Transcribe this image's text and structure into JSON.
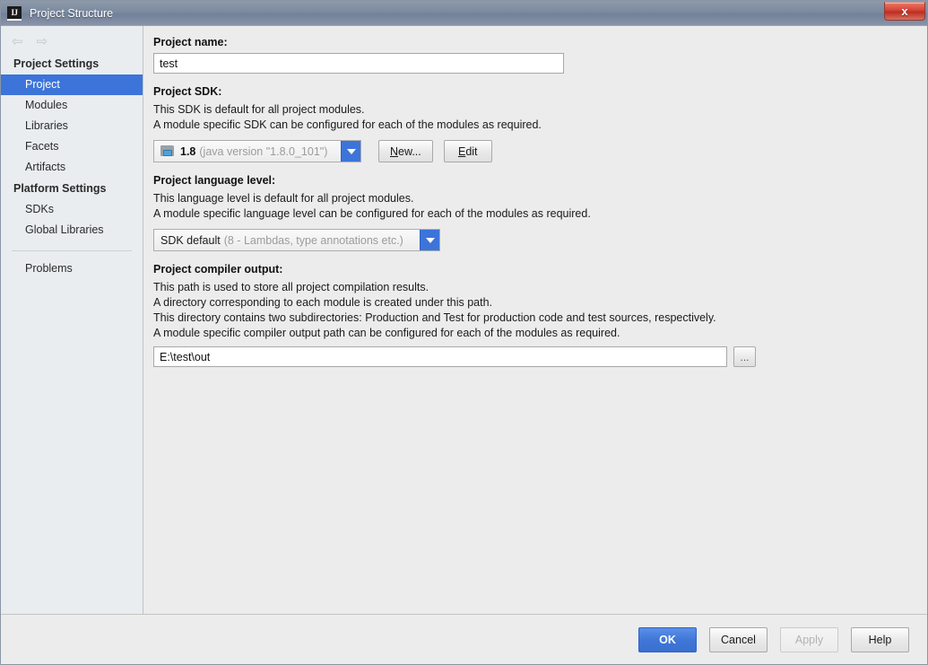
{
  "window": {
    "title": "Project Structure",
    "app_icon": "IJ",
    "close_label": "x"
  },
  "sidebar": {
    "nav": {
      "back_icon": "arrow-left-icon",
      "forward_icon": "arrow-right-icon",
      "back_glyph": "⇦",
      "forward_glyph": "⇨"
    },
    "groups": [
      {
        "title": "Project Settings",
        "items": [
          {
            "label": "Project",
            "selected": true
          },
          {
            "label": "Modules",
            "selected": false
          },
          {
            "label": "Libraries",
            "selected": false
          },
          {
            "label": "Facets",
            "selected": false
          },
          {
            "label": "Artifacts",
            "selected": false
          }
        ]
      },
      {
        "title": "Platform Settings",
        "items": [
          {
            "label": "SDKs",
            "selected": false
          },
          {
            "label": "Global Libraries",
            "selected": false
          }
        ]
      }
    ],
    "problems_label": "Problems"
  },
  "main": {
    "project_name": {
      "label": "Project name:",
      "value": "test"
    },
    "project_sdk": {
      "label": "Project SDK:",
      "description_lines": [
        "This SDK is default for all project modules.",
        "A module specific SDK can be configured for each of the modules as required."
      ],
      "selected_version": "1.8",
      "selected_detail": "(java version \"1.8.0_101\")",
      "new_button": {
        "prefix": "",
        "mnemonic": "N",
        "suffix": "ew..."
      },
      "edit_button": {
        "prefix": "",
        "mnemonic": "E",
        "suffix": "dit"
      }
    },
    "language_level": {
      "label": "Project language level:",
      "description_lines": [
        "This language level is default for all project modules.",
        "A module specific language level can be configured for each of the modules as required."
      ],
      "selected_value": "SDK default",
      "selected_detail": "(8 - Lambdas, type annotations etc.)"
    },
    "compiler_output": {
      "label": "Project compiler output:",
      "description_lines": [
        "This path is used to store all project compilation results.",
        "A directory corresponding to each module is created under this path.",
        "This directory contains two subdirectories: Production and Test for production code and test sources, respectively.",
        "A module specific compiler output path can be configured for each of the modules as required."
      ],
      "path_value": "E:\\test\\out",
      "browse_label": "..."
    }
  },
  "footer": {
    "ok_label": "OK",
    "cancel_label": "Cancel",
    "apply_label": "Apply",
    "help_label": "Help"
  },
  "colors": {
    "accent_blue": "#3c74d9",
    "titlebar_blue_gray": "#7c8a9e",
    "close_red": "#d8493a",
    "sidebar_bg": "#e9edf0",
    "content_bg": "#ececec"
  }
}
